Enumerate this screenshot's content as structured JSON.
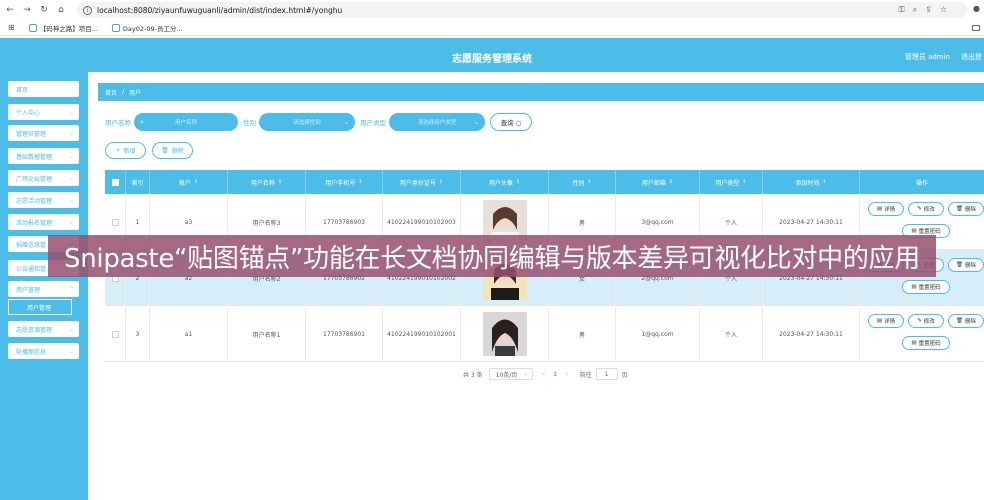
{
  "browser": {
    "url": "localhost:8080/ziyaunfuwuguanli/admin/dist/index.html#/yonghu",
    "bookmarks": [
      "【码神之路】项目...",
      "Day02-09-员工分..."
    ]
  },
  "header": {
    "title": "志愿服务管理系统",
    "user": "管理员 admin",
    "logout": "退出登"
  },
  "sidebar": {
    "items": [
      {
        "label": "首页",
        "chevron": false
      },
      {
        "label": "个人中心",
        "chevron": true
      },
      {
        "label": "管理员管理",
        "chevron": true
      },
      {
        "label": "基础数据管理",
        "chevron": true
      },
      {
        "label": "广场论坛管理",
        "chevron": true
      },
      {
        "label": "志愿活动管理",
        "chevron": true
      },
      {
        "label": "活动报名管理",
        "chevron": true
      },
      {
        "label": "捐赠信息管",
        "chevron": true
      },
      {
        "label": "公告通知管",
        "chevron": true
      },
      {
        "label": "用户管理",
        "chevron": true
      },
      {
        "label": "志愿资源管理",
        "chevron": true
      },
      {
        "label": "轮播图信息",
        "chevron": true
      }
    ],
    "active_sub": "用户管理"
  },
  "breadcrumb": {
    "home": "首页",
    "sep": "/",
    "current": "用户"
  },
  "search": {
    "name_label": "用户名称",
    "name_placeholder": "用户名称",
    "gender_label": "性别",
    "gender_placeholder": "请选择性别",
    "type_label": "用户类型",
    "type_placeholder": "请选择用户类型",
    "query_label": "查询 ○"
  },
  "actions": {
    "add": "新增",
    "delete": "删除"
  },
  "table": {
    "columns": [
      "索引",
      "账户",
      "用户名称",
      "用户手机号",
      "用户身份证号",
      "用户头像",
      "性别",
      "用户邮箱",
      "用户类型",
      "添加时间",
      "操作"
    ],
    "rows": [
      {
        "index": "1",
        "account": "a3",
        "name": "用户名称3",
        "phone": "17703786903",
        "idcard": "410224199010102003",
        "gender": "男",
        "email": "3@qq.com",
        "type": "个人",
        "time": "2023-04-27 14:30:11"
      },
      {
        "index": "2",
        "account": "a2",
        "name": "用户名称2",
        "phone": "17703786902",
        "idcard": "410224199010102002",
        "gender": "女",
        "email": "2@qq.com",
        "type": "个人",
        "time": "2023-04-27 14:30:11"
      },
      {
        "index": "3",
        "account": "a1",
        "name": "用户名称1",
        "phone": "17703786901",
        "idcard": "410224199010102001",
        "gender": "男",
        "email": "1@qq.com",
        "type": "个人",
        "time": "2023-04-27 14:30:11"
      }
    ],
    "ops": {
      "detail": "详情",
      "edit": "修改",
      "delete": "删除",
      "reset": "重置密码"
    }
  },
  "pager": {
    "total": "共 3 条",
    "size": "10条/页",
    "page": "1",
    "goto": "前往",
    "goto_val": "1",
    "unit": "页"
  },
  "overlay": {
    "text": "Snipaste“贴图锚点”功能在长文档协同编辑与版本差异可视化比对中的应用"
  },
  "colors": {
    "primary": "#4cbde8",
    "banner": "#96506e"
  }
}
